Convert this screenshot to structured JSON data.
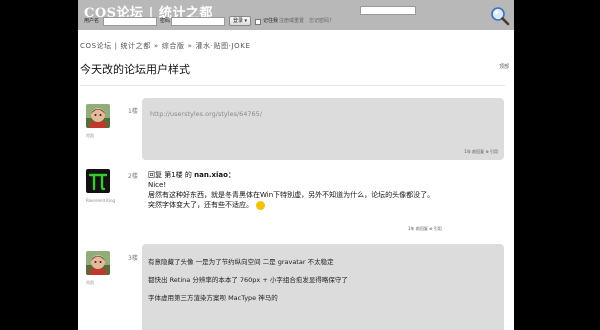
{
  "header": {
    "logo": "COS论坛 | 统计之都",
    "username_label": "用户名",
    "password_label": "密码",
    "login_button": "登录 ▾",
    "remember_label": "记住我",
    "register_link": "注册或重置",
    "forgot_link": "忘记密码？"
  },
  "breadcrumb": {
    "items": [
      "COS论坛 | 统计之都",
      "综合版",
      "灌水·贴图·JOKE"
    ],
    "separator": "»"
  },
  "topic": {
    "title": "今天改的论坛用户样式",
    "top_link": "顶部"
  },
  "posts": [
    {
      "floor": "1楼",
      "author": "肖凯",
      "url": "http://userstyles.org/styles/64765/",
      "meta": "1年 前回复 ⊕ 引用"
    },
    {
      "floor": "2楼",
      "author": "Reverend King",
      "reply_prefix": "回复 第1楼 的",
      "reply_to": "nan.xiao：",
      "lines": [
        "Nice!",
        "居然有这种好东西，就是冬青黑体在Win下特别虚，另外不知道为什么，论坛的头像都没了。",
        "突然字体变大了，还有些不适应。"
      ],
      "meta": "1年 前回复 ⊕ 引用"
    },
    {
      "floor": "3楼",
      "author": "肖凯",
      "lines": [
        "有意隐藏了头像 一是为了节约纵向空间 二是 gravatar 不太稳定",
        "都快出 Retina 分辨率的本本了 760px + 小字组合愈发显得略保守了",
        "字体虚用第三方渲染方案呗 MacType 神马的"
      ]
    }
  ],
  "colors": {
    "header_bg": "#b8b8b8",
    "bubble_bg": "#dcdcdc",
    "page_bg": "#ffffff",
    "outer_bg": "#000000"
  }
}
